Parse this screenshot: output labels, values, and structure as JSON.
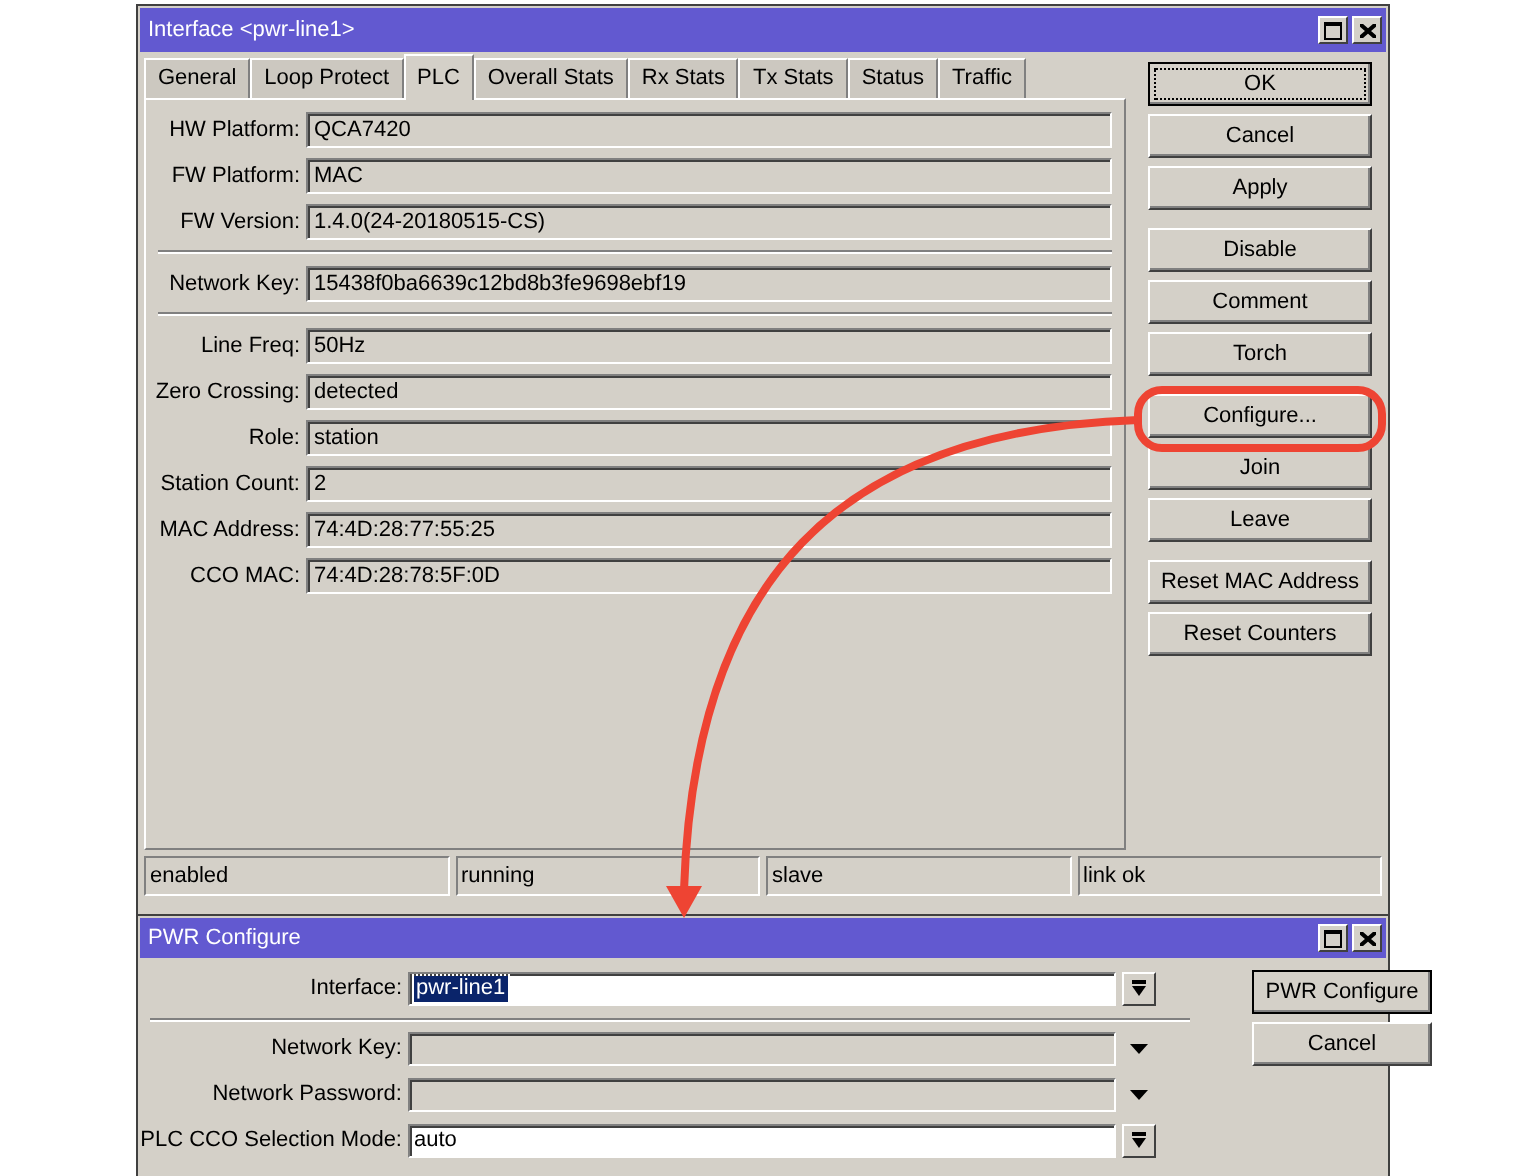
{
  "window": {
    "title": "Interface <pwr-line1>"
  },
  "tabs": [
    {
      "label": "General",
      "selected": false
    },
    {
      "label": "Loop Protect",
      "selected": false
    },
    {
      "label": "PLC",
      "selected": true
    },
    {
      "label": "Overall Stats",
      "selected": false
    },
    {
      "label": "Rx Stats",
      "selected": false
    },
    {
      "label": "Tx Stats",
      "selected": false
    },
    {
      "label": "Status",
      "selected": false
    },
    {
      "label": "Traffic",
      "selected": false
    }
  ],
  "field_groups": [
    [
      {
        "label": "HW Platform:",
        "value": "QCA7420"
      },
      {
        "label": "FW Platform:",
        "value": "MAC"
      },
      {
        "label": "FW Version:",
        "value": "1.4.0(24-20180515-CS)"
      }
    ],
    [
      {
        "label": "Network Key:",
        "value": "15438f0ba6639c12bd8b3fe9698ebf19"
      }
    ],
    [
      {
        "label": "Line Freq:",
        "value": "50Hz"
      },
      {
        "label": "Zero Crossing:",
        "value": "detected"
      },
      {
        "label": "Role:",
        "value": "station"
      },
      {
        "label": "Station Count:",
        "value": "2"
      },
      {
        "label": "MAC Address:",
        "value": "74:4D:28:77:55:25"
      },
      {
        "label": "CCO MAC:",
        "value": "74:4D:28:78:5F:0D"
      }
    ]
  ],
  "button_groups": [
    [
      {
        "label": "OK",
        "default": true,
        "highlighted": false
      },
      {
        "label": "Cancel",
        "default": false,
        "highlighted": false
      },
      {
        "label": "Apply",
        "default": false,
        "highlighted": false
      }
    ],
    [
      {
        "label": "Disable",
        "default": false,
        "highlighted": false
      },
      {
        "label": "Comment",
        "default": false,
        "highlighted": false
      },
      {
        "label": "Torch",
        "default": false,
        "highlighted": false
      }
    ],
    [
      {
        "label": "Configure...",
        "default": false,
        "highlighted": true
      },
      {
        "label": "Join",
        "default": false,
        "highlighted": false
      },
      {
        "label": "Leave",
        "default": false,
        "highlighted": false
      }
    ],
    [
      {
        "label": "Reset MAC Address",
        "default": false,
        "highlighted": false
      },
      {
        "label": "Reset Counters",
        "default": false,
        "highlighted": false
      }
    ]
  ],
  "status_bar": [
    "enabled",
    "running",
    "slave",
    "link ok"
  ],
  "dialog": {
    "title": "PWR Configure",
    "field_groups": [
      [
        {
          "label": "Interface:",
          "value": "pwr-line1",
          "kind": "select",
          "disabled": false,
          "highlighted": true
        }
      ],
      [
        {
          "label": "Network Key:",
          "kind": "combo",
          "disabled": true
        },
        {
          "label": "Network Password:",
          "kind": "combo",
          "disabled": true
        },
        {
          "label": "PLC CCO Selection Mode:",
          "value": "auto",
          "kind": "select",
          "disabled": false,
          "highlighted": false
        }
      ]
    ],
    "buttons": [
      {
        "label": "PWR Configure",
        "default": true
      },
      {
        "label": "Cancel",
        "default": false
      }
    ]
  }
}
